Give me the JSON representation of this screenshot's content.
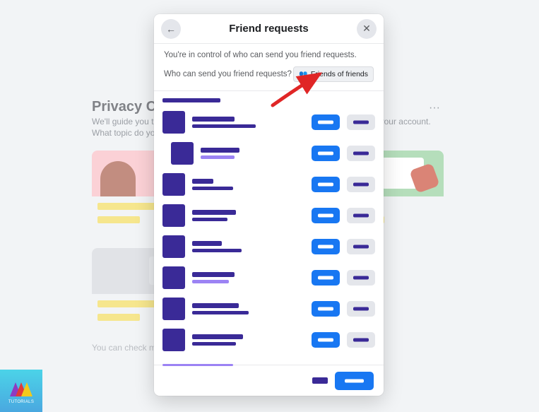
{
  "background": {
    "title": "Privacy Checkup",
    "subtitle_line1": "We'll guide you through some settings so you can make the right choices for your account.",
    "subtitle_line2": "What topic do you want to start with?",
    "bottom_note": "You can check more privacy settings on Facebook in settings."
  },
  "modal": {
    "title": "Friend requests",
    "intro": "You're in control of who can send you friend requests.",
    "question": "Who can send you friend requests?",
    "selector_label": "Friends of friends",
    "selector_icon": "friends-icon"
  },
  "list_items": [
    {
      "line1_w": 60,
      "line2_w": 90,
      "line2_color": "#3a2a97",
      "indent": 0,
      "has_intro": true
    },
    {
      "line1_w": 55,
      "line2_w": 48,
      "line2_color": "#9c83f4",
      "indent": 12
    },
    {
      "line1_w": 30,
      "line2_w": 58,
      "line2_color": "#3a2a97",
      "indent": 0
    },
    {
      "line1_w": 62,
      "line2_w": 50,
      "line2_color": "#3a2a97",
      "indent": 0
    },
    {
      "line1_w": 42,
      "line2_w": 70,
      "line2_color": "#3a2a97",
      "indent": 0
    },
    {
      "line1_w": 60,
      "line2_w": 52,
      "line2_color": "#9c83f4",
      "indent": 0
    },
    {
      "line1_w": 66,
      "line2_w": 80,
      "line2_color": "#3a2a97",
      "indent": 0
    },
    {
      "line1_w": 72,
      "line2_w": 62,
      "line2_color": "#3a2a97",
      "indent": 0
    }
  ]
}
